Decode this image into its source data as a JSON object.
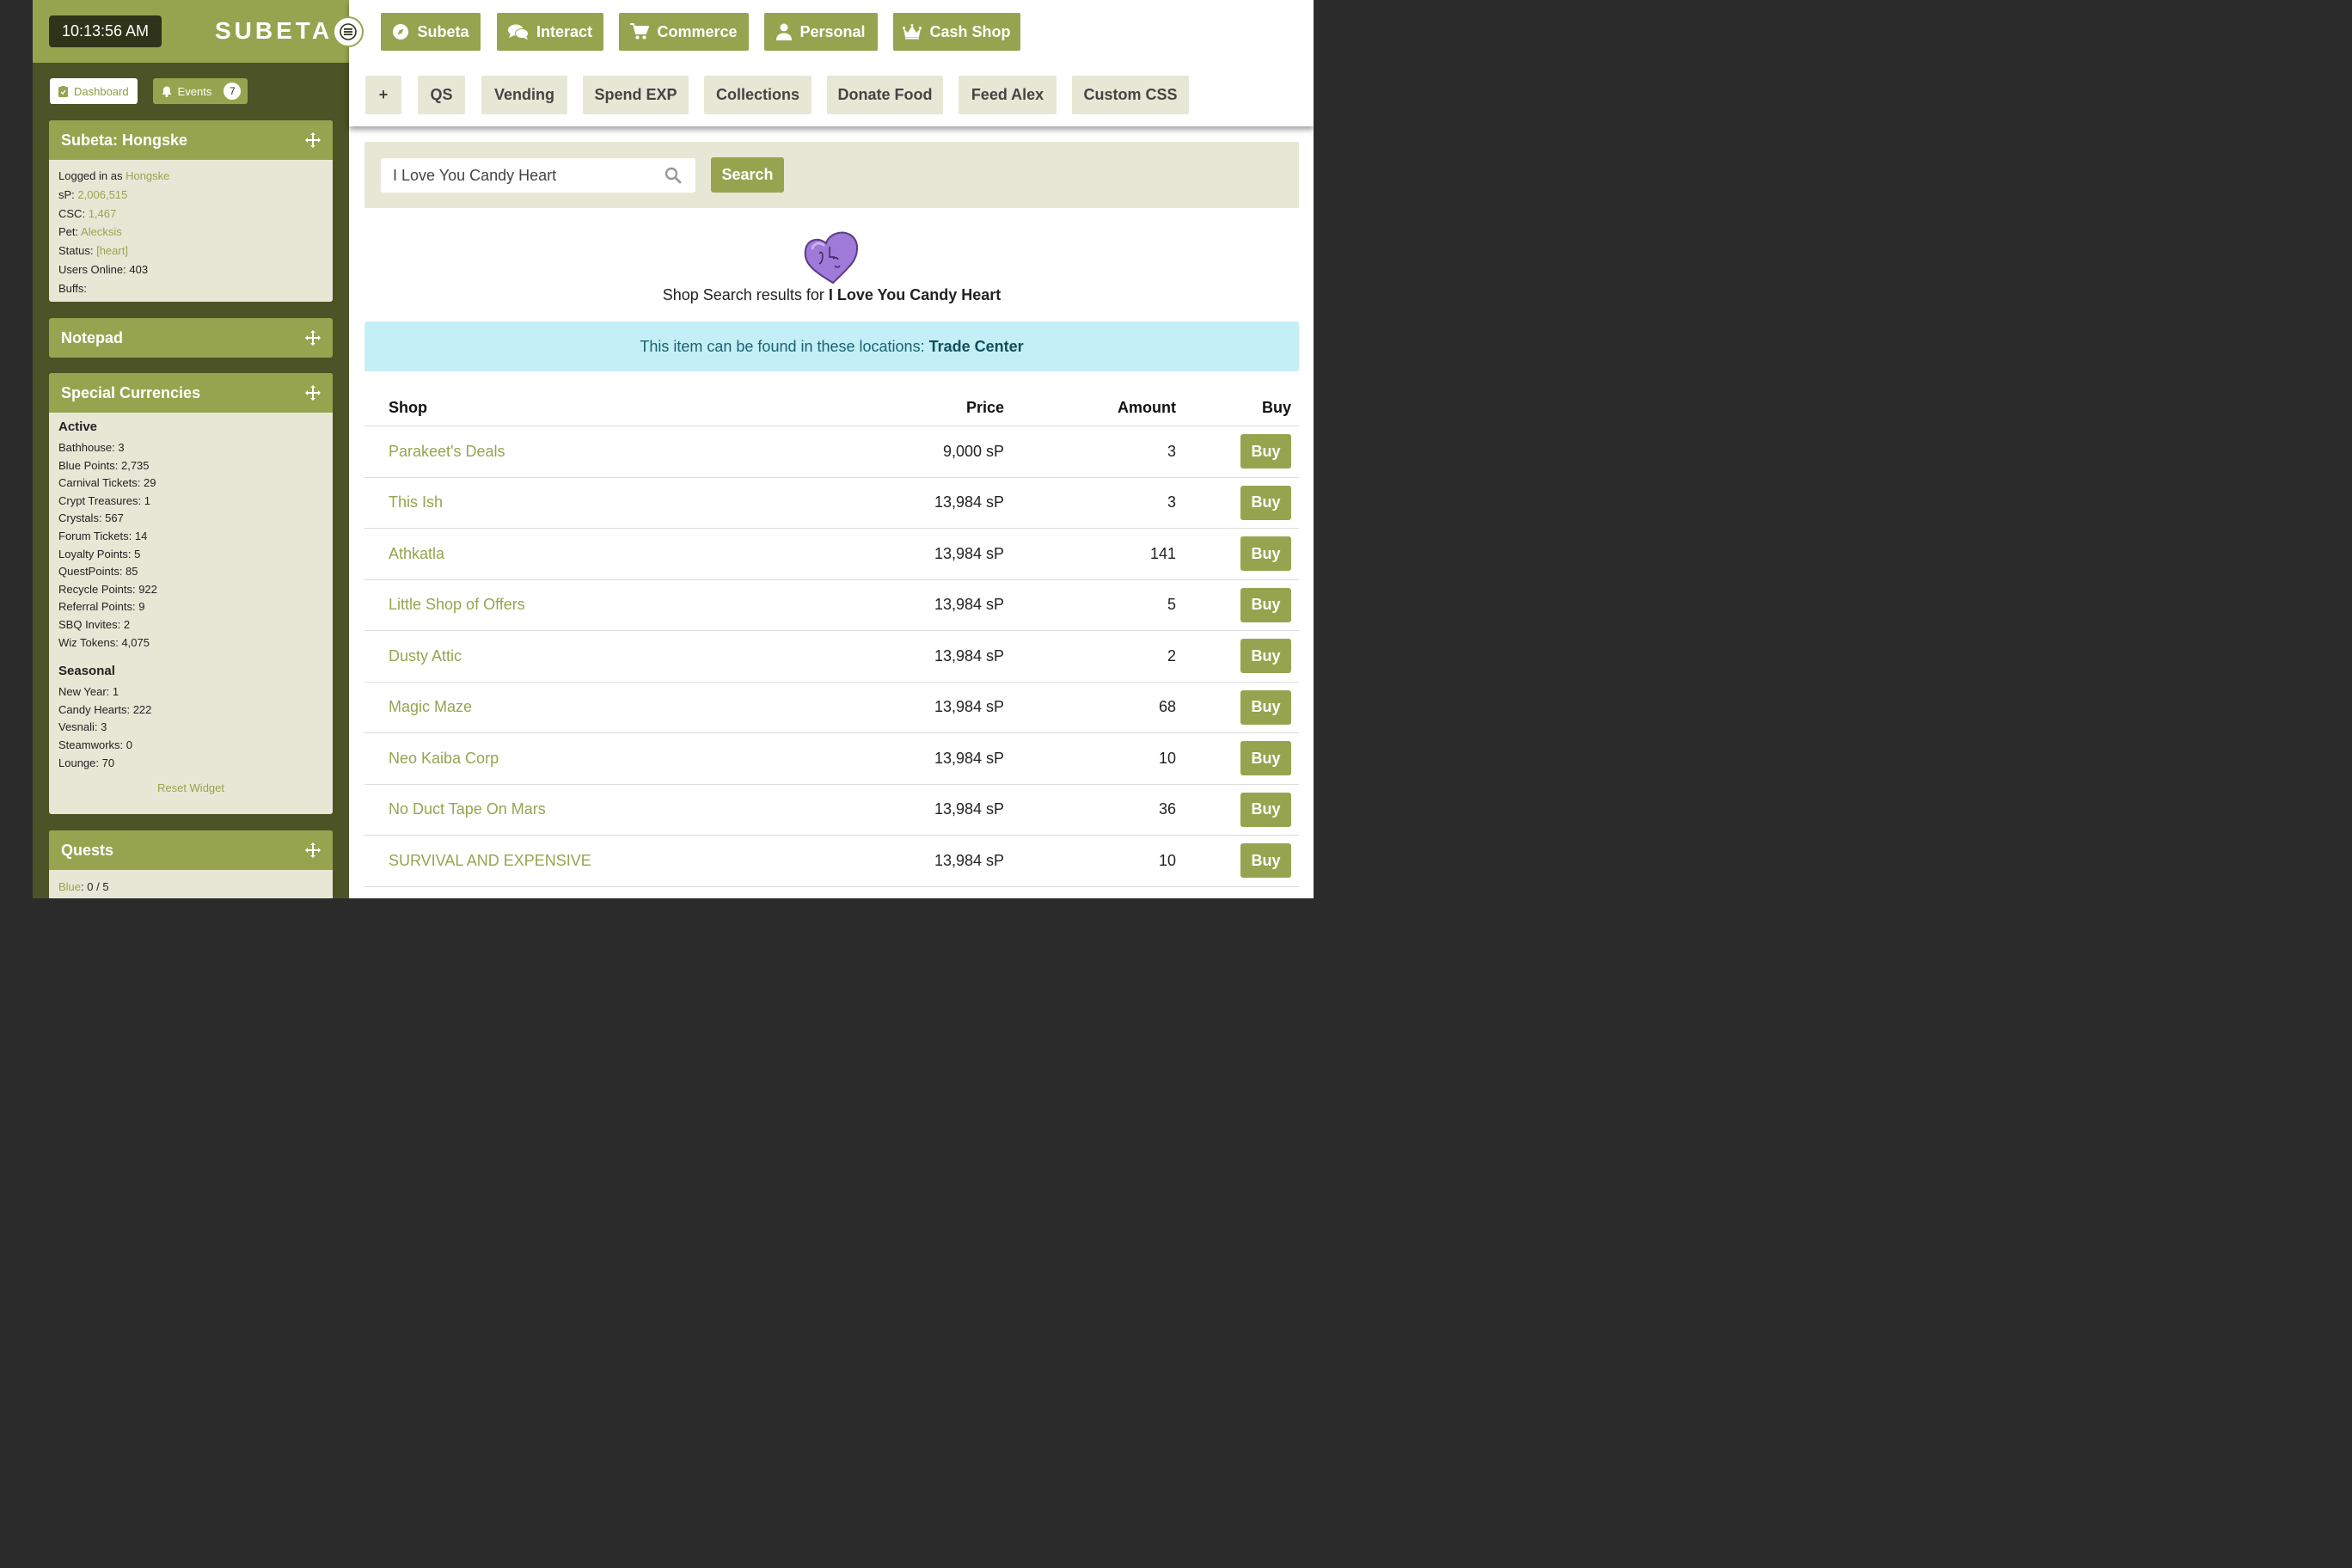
{
  "clock": "10:13:56 AM",
  "logo": "SUBETA",
  "side_buttons": {
    "dashboard": "Dashboard",
    "events": "Events",
    "events_count": "7"
  },
  "top_nav": [
    {
      "label": "Subeta",
      "icon": "compass-icon"
    },
    {
      "label": "Interact",
      "icon": "chat-bubbles-icon"
    },
    {
      "label": "Commerce",
      "icon": "cart-icon"
    },
    {
      "label": "Personal",
      "icon": "user-icon"
    },
    {
      "label": "Cash Shop",
      "icon": "crown-icon"
    }
  ],
  "sub_nav": [
    "+",
    "QS",
    "Vending",
    "Spend EXP",
    "Collections",
    "Donate Food",
    "Feed Alex",
    "Custom CSS"
  ],
  "widget_user": {
    "title": "Subeta: Hongske",
    "logged_in_label": "Logged in as",
    "logged_in_value": "Hongske",
    "sp_label": "sP:",
    "sp_value": "2,006,515",
    "csc_label": "CSC:",
    "csc_value": "1,467",
    "pet_label": "Pet:",
    "pet_value": "Alecksis",
    "status_label": "Status:",
    "status_value": "[heart]",
    "users_online": "Users Online: 403",
    "buffs": "Buffs:"
  },
  "widget_notepad": {
    "title": "Notepad"
  },
  "widget_currencies": {
    "title": "Special Currencies",
    "active_heading": "Active",
    "active": [
      "Bathhouse: 3",
      "Blue Points: 2,735",
      "Carnival Tickets: 29",
      "Crypt Treasures: 1",
      "Crystals: 567",
      "Forum Tickets: 14",
      "Loyalty Points: 5",
      "QuestPoints: 85",
      "Recycle Points: 922",
      "Referral Points: 9",
      "SBQ Invites: 2",
      "Wiz Tokens: 4,075"
    ],
    "seasonal_heading": "Seasonal",
    "seasonal": [
      "New Year: 1",
      "Candy Hearts: 222",
      "Vesnali: 3",
      "Steamworks: 0",
      "Lounge: 70"
    ],
    "reset": "Reset Widget"
  },
  "widget_quests": {
    "title": "Quests",
    "blue_label": "Blue",
    "blue_value": ": 0 / 5"
  },
  "search": {
    "value": "I Love You Candy Heart",
    "button": "Search"
  },
  "results": {
    "prefix": "Shop Search results for",
    "item": "I Love You Candy Heart"
  },
  "locations": {
    "text": "This item can be found in these locations:",
    "link": "Trade Center"
  },
  "table": {
    "headers": {
      "shop": "Shop",
      "price": "Price",
      "amount": "Amount",
      "buy": "Buy"
    },
    "rows": [
      {
        "shop": "Parakeet's Deals",
        "price": "9,000 sP",
        "amount": "3",
        "buy": "Buy"
      },
      {
        "shop": "This Ish",
        "price": "13,984 sP",
        "amount": "3",
        "buy": "Buy"
      },
      {
        "shop": "Athkatla",
        "price": "13,984 sP",
        "amount": "141",
        "buy": "Buy"
      },
      {
        "shop": "Little Shop of Offers",
        "price": "13,984 sP",
        "amount": "5",
        "buy": "Buy"
      },
      {
        "shop": "Dusty Attic",
        "price": "13,984 sP",
        "amount": "2",
        "buy": "Buy"
      },
      {
        "shop": "Magic Maze",
        "price": "13,984 sP",
        "amount": "68",
        "buy": "Buy"
      },
      {
        "shop": "Neo Kaiba Corp",
        "price": "13,984 sP",
        "amount": "10",
        "buy": "Buy"
      },
      {
        "shop": "No Duct Tape On Mars",
        "price": "13,984 sP",
        "amount": "36",
        "buy": "Buy"
      },
      {
        "shop": "SURVIVAL AND EXPENSIVE",
        "price": "13,984 sP",
        "amount": "10",
        "buy": "Buy"
      }
    ]
  },
  "colors": {
    "accent": "#97a44f",
    "sidebar": "#4b5327",
    "panel": "#e6e8d5",
    "info": "#c4eff6"
  }
}
